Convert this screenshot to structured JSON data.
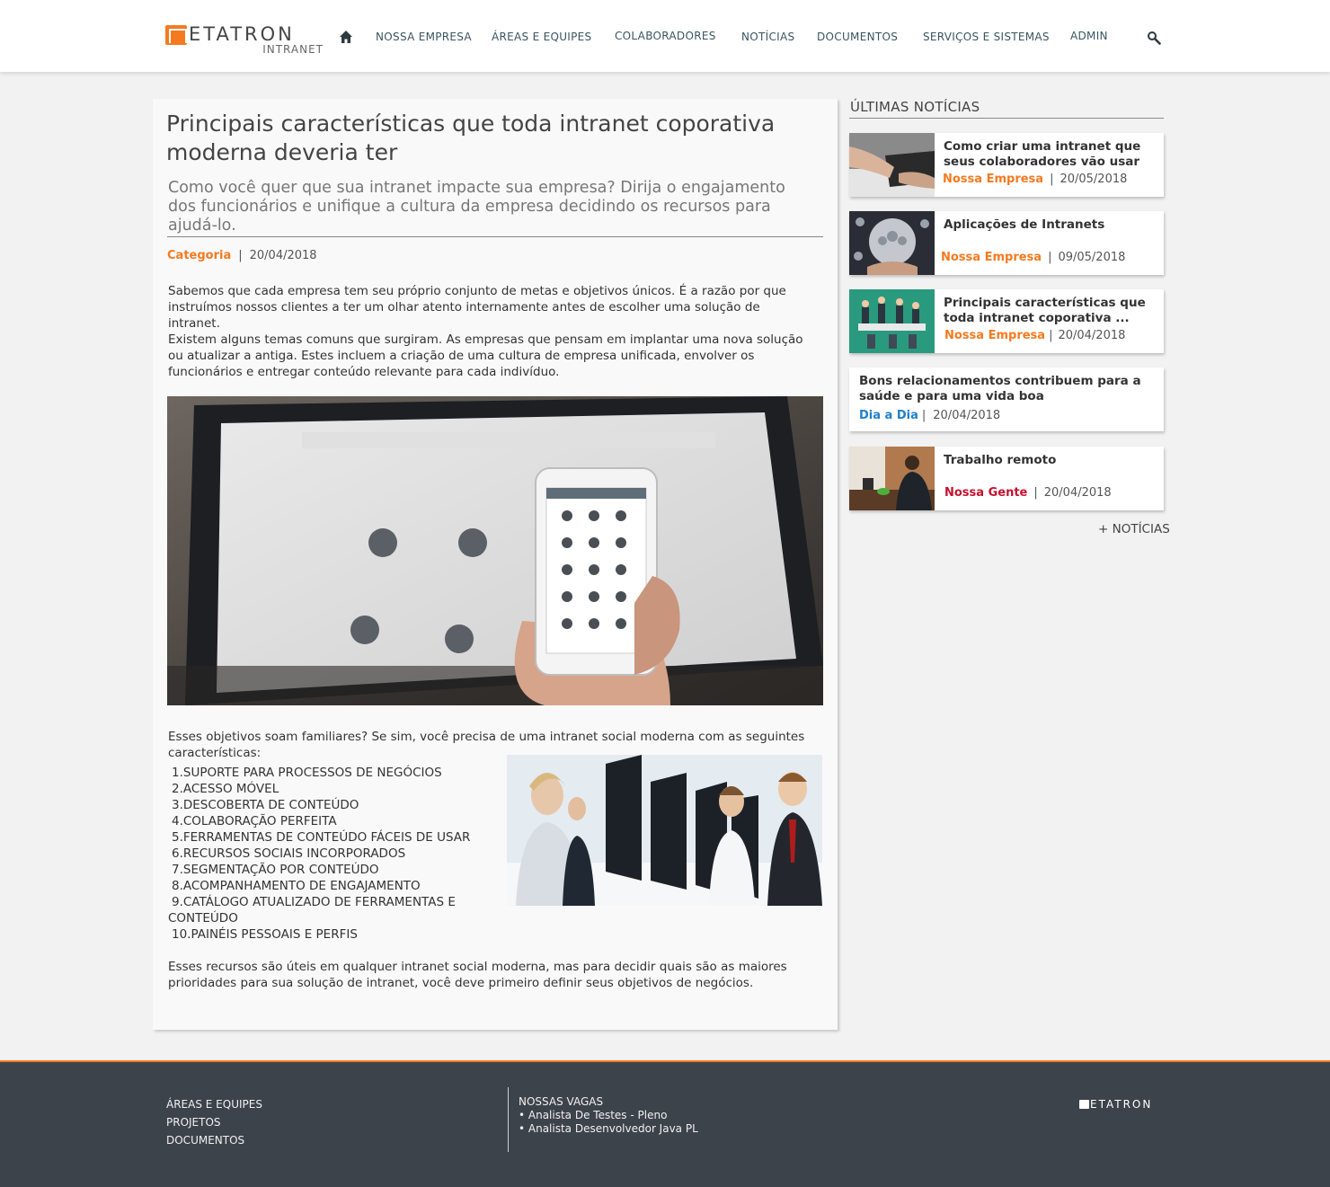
{
  "header": {
    "logo_word": "ETATRON",
    "logo_sub": "INTRANET",
    "nav": [
      {
        "label": "NOSSA EMPRESA"
      },
      {
        "label": "ÁREAS E EQUIPES"
      },
      {
        "label": "COLABORADORES"
      },
      {
        "label": "NOTÍCIAS"
      },
      {
        "label": "DOCUMENTOS"
      },
      {
        "label": "SERVIÇOS E SISTEMAS"
      },
      {
        "label": "ADMIN"
      }
    ],
    "icons": {
      "home": "home-icon",
      "search": "search-icon"
    },
    "accent": "#f47a20"
  },
  "article": {
    "title": "Principais características que toda intranet coporativa moderna deveria ter",
    "subtitle": "Como você quer que sua intranet impacte sua empresa? Dirija o engajamento dos funcionários e unifique a cultura da empresa decidindo os recursos para ajudá-lo.",
    "category": "Categoria",
    "separator": "|",
    "date": "20/04/2018",
    "paragraphs": [
      "Sabemos que cada empresa tem seu próprio conjunto de metas e objetivos únicos. É a razão por que instruímos nossos clientes a ter um olhar atento internamente antes de escolher uma solução de intranet.",
      "Existem alguns temas comuns que surgiram. As empresas que pensam em implantar uma nova solução ou atualizar a antiga. Estes incluem a criação de uma cultura de empresa unificada, envolver os funcionários e entregar conteúdo relevante para cada indivíduo.",
      "Esses objetivos soam familiares? Se sim, você precisa de uma intranet social moderna com as seguintes características:",
      "Esses recursos são úteis em qualquer intranet social moderna, mas para decidir quais são as maiores prioridades para sua solução de intranet, você deve primeiro definir seus objetivos de negócios."
    ],
    "features": [
      "1.SUPORTE PARA PROCESSOS DE NEGÓCIOS",
      "2.ACESSO MÓVEL",
      "3.DESCOBERTA DE CONTEÚDO",
      "4.COLABORAÇÃO PERFEITA",
      "5.FERRAMENTAS DE CONTEÚDO FÁCEIS DE USAR",
      "6.RECURSOS SOCIAIS INCORPORADOS",
      "7.SEGMENTAÇÃO POR CONTEÚDO",
      "8.ACOMPANHAMENTO DE ENGAJAMENTO",
      "9.CATÁLOGO ATUALIZADO DE FERRAMENTAS E CONTEÚDO",
      "10.PAINÉIS PESSOAIS E PERFIS"
    ]
  },
  "sidebar": {
    "title": "ÚLTIMAS NOTÍCIAS",
    "separator": "|",
    "news": [
      {
        "title": "Como criar uma intranet que seus colaboradores vão usar",
        "category": "Nossa Empresa",
        "category_color": "#f47a20",
        "date": "20/05/2018"
      },
      {
        "title": "Aplicações de Intranets",
        "category": "Nossa Empresa",
        "category_color": "#f47a20",
        "date": "09/05/2018"
      },
      {
        "title": "Principais características que toda intranet coporativa ...",
        "category": "Nossa Empresa",
        "category_color": "#f47a20",
        "date": "20/04/2018"
      },
      {
        "title": "Bons relacionamentos contribuem para a saúde e para uma vida boa",
        "category": "Dia a Dia",
        "category_color": "#1f7fc9",
        "date": "20/04/2018"
      },
      {
        "title": "Trabalho remoto",
        "category": "Nossa Gente",
        "category_color": "#c8102e",
        "date": "20/04/2018"
      }
    ],
    "more_label": "+ NOTÍCIAS"
  },
  "footer": {
    "links": [
      "ÁREAS E EQUIPES",
      "PROJETOS",
      "DOCUMENTOS"
    ],
    "jobs_title": "NOSSAS VAGAS",
    "jobs": [
      "• Analista De Testes - Pleno",
      "• Analista Desenvolvedor Java PL"
    ],
    "logo_word": "ETATRON"
  }
}
